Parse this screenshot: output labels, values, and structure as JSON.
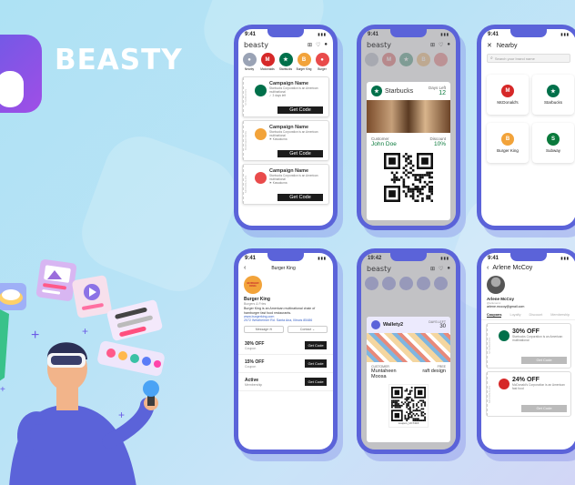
{
  "brand": {
    "name": "BEASTY"
  },
  "status": {
    "time1": "9:41",
    "time2": "19:42"
  },
  "phone1": {
    "app_title": "beasty",
    "brands": [
      {
        "label": "Nearby",
        "color": "#9aa3b5",
        "glyph": "●"
      },
      {
        "label": "Mcdonalds",
        "color": "#d62828",
        "glyph": "M"
      },
      {
        "label": "Starbucks",
        "color": "#00704a",
        "glyph": "★"
      },
      {
        "label": "Burger King",
        "color": "#f2a33a",
        "glyph": "B"
      },
      {
        "label": "Burger",
        "color": "#e94b4b",
        "glyph": "●"
      }
    ],
    "campaigns": [
      {
        "side": "STARBUCKS",
        "name": "Campaign Name",
        "desc": "Starbucks Corporation is an American multinational",
        "meta": "✓ 3 days left",
        "btn": "Get Code",
        "color": "#00704a"
      },
      {
        "side": "BURGER KING",
        "name": "Campaign Name",
        "desc": "Starbucks Corporation is an American multinational",
        "meta": "⚑ Kawakuma",
        "btn": "Get Code",
        "color": "#f2a33a"
      },
      {
        "side": "MCDONALDS",
        "name": "Campaign Name",
        "desc": "Starbucks Corporation is an American multinational",
        "meta": "⚑ Kawakuma",
        "btn": "Get Code",
        "color": "#e94b4b"
      }
    ]
  },
  "phone2": {
    "brand": "Starbucks",
    "days_label": "Days Left",
    "days_value": "12",
    "customer_label": "Customer",
    "customer_value": "John Doe",
    "discount_label": "Discount",
    "discount_value": "10%"
  },
  "phone3": {
    "title": "Nearby",
    "search_placeholder": "Search your brand name",
    "tiles": [
      {
        "label": "McDonald's",
        "color": "#d62828",
        "glyph": "M"
      },
      {
        "label": "Starbucks",
        "color": "#00704a",
        "glyph": "★"
      },
      {
        "label": "Burger King",
        "color": "#f2a33a",
        "glyph": "B"
      },
      {
        "label": "Subway",
        "color": "#0a7a3c",
        "glyph": "S"
      }
    ]
  },
  "phone4": {
    "title": "Burger King",
    "logo_text": "BURGER KING",
    "name": "Burger King",
    "category": "Burgers & Fries",
    "desc": "Burger King is an American multinational chain of hamburger fast food restaurants.",
    "site": "www.burgerking.com",
    "address": "2072 Westheimer Rd. Santa Ana, Illinois 85486",
    "message_btn": "Message",
    "contact_btn": "Contact",
    "offers": [
      {
        "title": "30% OFF",
        "sub": "Coupon",
        "btn": "Get Code"
      },
      {
        "title": "15% OFF",
        "sub": "Coupon",
        "btn": "Get Code"
      },
      {
        "title": "Active",
        "sub": "Membership",
        "btn": "Get Code"
      }
    ]
  },
  "phone5": {
    "app_title": "beasty",
    "card_title": "Wallety2",
    "days_label": "DAYS LEFT",
    "days_value": "30",
    "customer_label": "CUSTOMER",
    "customer_value": "Muntaheen Moosa",
    "field_label": "FREE",
    "field_value": "raft design",
    "code": "coupon_UC7416"
  },
  "phone6": {
    "title": "Arlene McCoy",
    "name": "Arlene McCoy",
    "handle": "@arlenemc",
    "email": "arlene.mccoy@gmail.com",
    "tabs": [
      "Coupons",
      "Loyalty",
      "Discount",
      "Membership"
    ],
    "coupons": [
      {
        "side": "STARBUCKS",
        "pct": "30% OFF",
        "desc": "Starbucks Corporation is an American multinational",
        "btn": "Get Code",
        "color": "#00704a"
      },
      {
        "side": "MCDONALDS",
        "pct": "24% OFF",
        "desc": "McDonald's Corporation is an American fast food",
        "btn": "Get Code",
        "color": "#d62828"
      }
    ]
  }
}
